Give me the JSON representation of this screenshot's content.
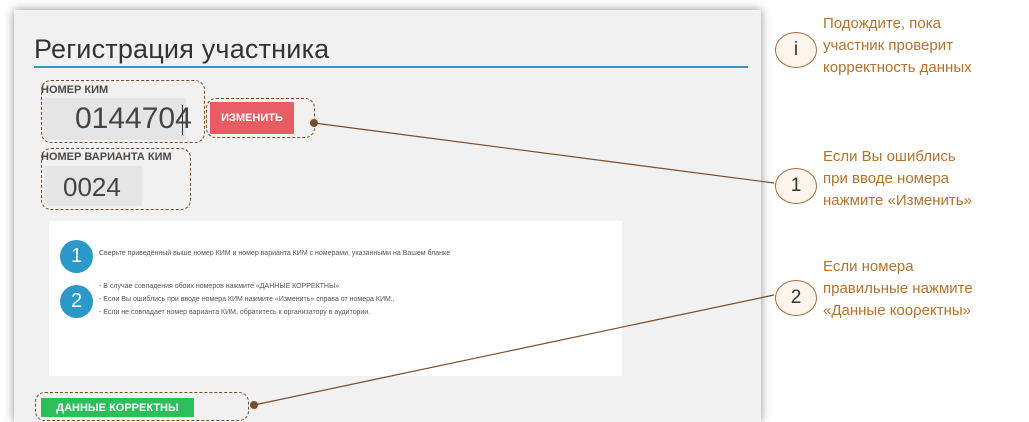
{
  "form": {
    "title": "Регистрация участника",
    "kim_label": "НОМЕР КИМ",
    "kim_value": "0144704",
    "change_button": "ИЗМЕНИТЬ",
    "variant_label": "НОМЕР ВАРИАНТА КИМ",
    "variant_value": "0024",
    "confirm_button": "ДАННЫЕ КОРРЕКТНЫ"
  },
  "instructions": {
    "step1_number": "1",
    "step1_text": "Сверьте приведённый выше номер КИМ и номер варианта КИМ с номерами, указанными на Вашем бланке",
    "step2_number": "2",
    "step2_lines": [
      "- В случае совпадения обоих номеров нажмите «ДАННЫЕ КОРРЕКТНЫ»",
      "- Если Вы ошиблись при вводе номера КИМ нажмите «Изменить» справа от номера КИМ.,",
      "- Если не совпадает номер варианта КИМ, обратитесь к организатору в аудитории."
    ]
  },
  "callouts": [
    {
      "marker": "i",
      "lines": [
        "Подождите, пока",
        "участник проверит",
        "корректность данных"
      ]
    },
    {
      "marker": "1",
      "lines": [
        "Если Вы ошиблись",
        "при вводе номера",
        "нажмите «Изменить»"
      ]
    },
    {
      "marker": "2",
      "lines": [
        "Если номера",
        "правильные нажмите",
        "«Данные коορектны»"
      ]
    }
  ],
  "colors": {
    "accent_line": "#3d95bd",
    "change_button": "#e85c63",
    "confirm_button": "#2dbd5a",
    "step_circle": "#2a98c8",
    "callout_text": "#b5722d"
  }
}
